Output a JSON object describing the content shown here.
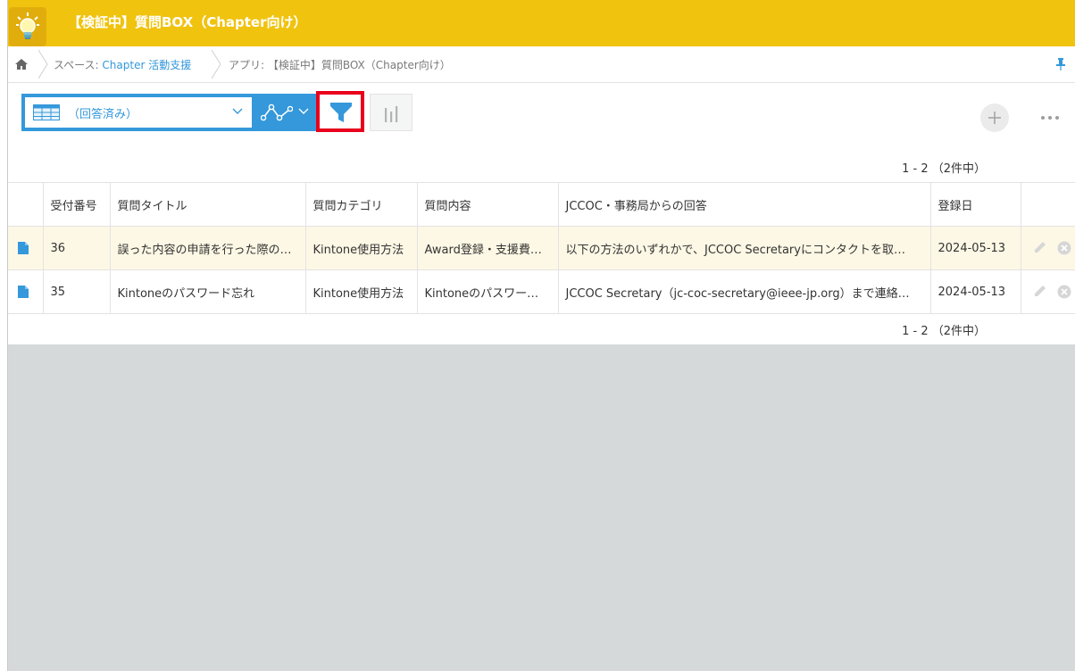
{
  "app": {
    "title": "【検証中】質問BOX（Chapter向け）",
    "accent": "#f0c30f"
  },
  "breadcrumb": {
    "space_prefix": "スペース: ",
    "space_name": "Chapter 活動支援",
    "app_label": "アプリ: 【検証中】質問BOX（Chapter向け）"
  },
  "toolbar": {
    "view_name": "（回答済み）",
    "icons": [
      "table-view-icon",
      "graph-icon",
      "filter-icon",
      "chart-icon",
      "add-icon",
      "more-icon"
    ]
  },
  "pager": {
    "top": "1 - 2 （2件中）",
    "bottom": "1 - 2 （2件中）"
  },
  "table": {
    "columns": [
      "受付番号",
      "質問タイトル",
      "質問カテゴリ",
      "質問内容",
      "JCCOC・事務局からの回答",
      "登録日"
    ],
    "rows": [
      {
        "number": "36",
        "title": "誤った内容の申請を行った際の…",
        "category": "Kintone使用方法",
        "content": "Award登録・支援費…",
        "answer": "以下の方法のいずれかで、JCCOC Secretaryにコンタクトを取…",
        "date": "2024-05-13"
      },
      {
        "number": "35",
        "title": "Kintoneのパスワード忘れ",
        "category": "Kintone使用方法",
        "content": "Kintoneのパスワー…",
        "answer": "JCCOC Secretary（jc-coc-secretary@ieee-jp.org）まで連絡…",
        "date": "2024-05-13"
      }
    ]
  }
}
